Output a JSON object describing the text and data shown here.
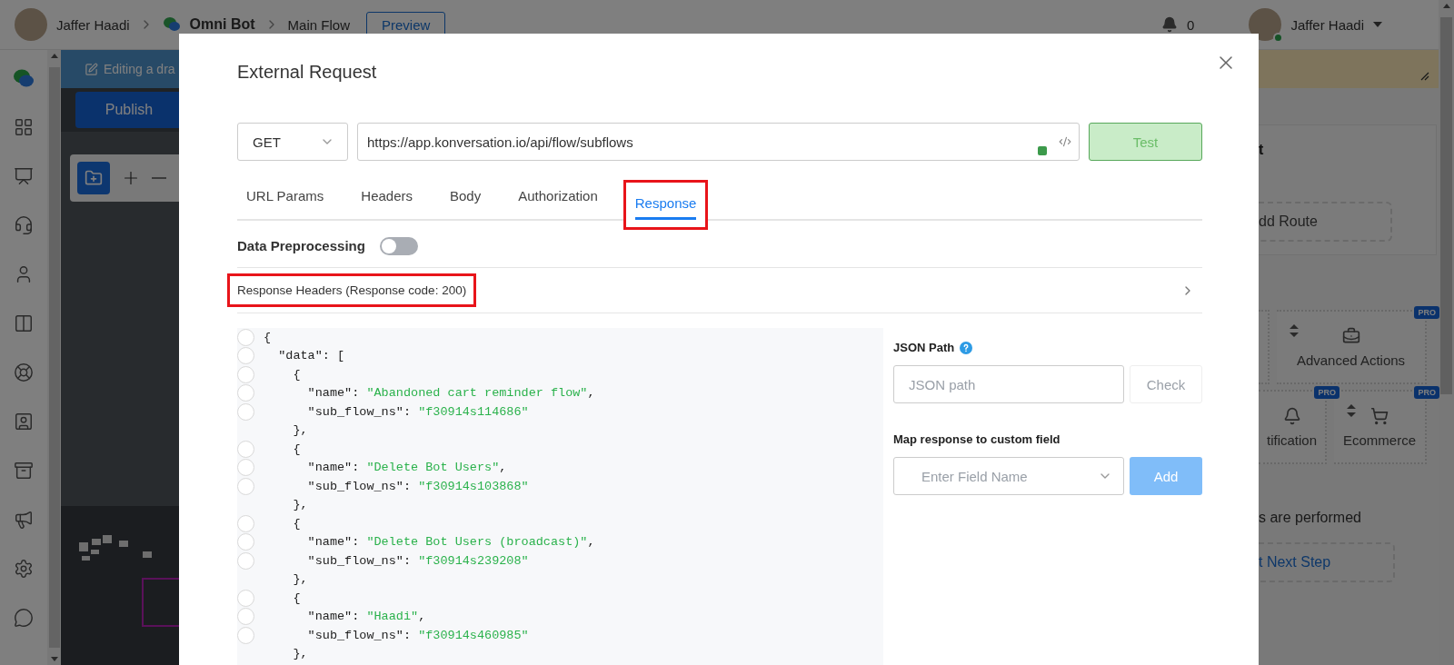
{
  "top_bar": {
    "user_name": "Jaffer Haadi",
    "bot_name": "Omni Bot",
    "flow_name": "Main Flow",
    "preview_button": "Preview",
    "notification_count": "0",
    "account_name": "Jaffer Haadi"
  },
  "editor": {
    "banner": "Editing a dra",
    "publish_button": "Publish"
  },
  "right_panel": {
    "heading": "t",
    "add_route": "dd Route",
    "actions": [
      {
        "label": "Advanced Actions",
        "badge": "PRO"
      },
      {
        "label": "tification",
        "badge": "PRO"
      },
      {
        "label": "Ecommerce",
        "badge": "PRO"
      }
    ],
    "note": "s are performed",
    "next_step": "t Next Step"
  },
  "modal": {
    "title": "External Request",
    "method": "GET",
    "url": "https://app.konversation.io/api/flow/subflows",
    "test_button": "Test",
    "tabs": [
      {
        "label": "URL Params",
        "selected": false,
        "highlighted": false
      },
      {
        "label": "Headers",
        "selected": false,
        "highlighted": false
      },
      {
        "label": "Body",
        "selected": false,
        "highlighted": false
      },
      {
        "label": "Authorization",
        "selected": false,
        "highlighted": false
      },
      {
        "label": "Response",
        "selected": true,
        "highlighted": true
      }
    ],
    "data_preprocessing": {
      "label": "Data Preprocessing",
      "on": false
    },
    "response_headers": {
      "label": "Response Headers (Response code: 200)",
      "highlighted": true
    },
    "code_lines": [
      {
        "fold": true,
        "parts": [
          {
            "kind": "plain",
            "text": "{"
          }
        ]
      },
      {
        "fold": true,
        "parts": [
          {
            "kind": "plain",
            "text": "  \"data\": ["
          }
        ]
      },
      {
        "fold": true,
        "parts": [
          {
            "kind": "plain",
            "text": "    {"
          }
        ]
      },
      {
        "fold": true,
        "parts": [
          {
            "kind": "plain",
            "text": "      \"name\": "
          },
          {
            "kind": "string",
            "text": "\"Abandoned cart reminder flow\""
          },
          {
            "kind": "plain",
            "text": ","
          }
        ]
      },
      {
        "fold": true,
        "parts": [
          {
            "kind": "plain",
            "text": "      \"sub_flow_ns\": "
          },
          {
            "kind": "string",
            "text": "\"f30914s114686\""
          }
        ]
      },
      {
        "fold": false,
        "parts": [
          {
            "kind": "plain",
            "text": "    },"
          }
        ]
      },
      {
        "fold": true,
        "parts": [
          {
            "kind": "plain",
            "text": "    {"
          }
        ]
      },
      {
        "fold": true,
        "parts": [
          {
            "kind": "plain",
            "text": "      \"name\": "
          },
          {
            "kind": "string",
            "text": "\"Delete Bot Users\""
          },
          {
            "kind": "plain",
            "text": ","
          }
        ]
      },
      {
        "fold": true,
        "parts": [
          {
            "kind": "plain",
            "text": "      \"sub_flow_ns\": "
          },
          {
            "kind": "string",
            "text": "\"f30914s103868\""
          }
        ]
      },
      {
        "fold": false,
        "parts": [
          {
            "kind": "plain",
            "text": "    },"
          }
        ]
      },
      {
        "fold": true,
        "parts": [
          {
            "kind": "plain",
            "text": "    {"
          }
        ]
      },
      {
        "fold": true,
        "parts": [
          {
            "kind": "plain",
            "text": "      \"name\": "
          },
          {
            "kind": "string",
            "text": "\"Delete Bot Users (broadcast)\""
          },
          {
            "kind": "plain",
            "text": ","
          }
        ]
      },
      {
        "fold": true,
        "parts": [
          {
            "kind": "plain",
            "text": "      \"sub_flow_ns\": "
          },
          {
            "kind": "string",
            "text": "\"f30914s239208\""
          }
        ]
      },
      {
        "fold": false,
        "parts": [
          {
            "kind": "plain",
            "text": "    },"
          }
        ]
      },
      {
        "fold": true,
        "parts": [
          {
            "kind": "plain",
            "text": "    {"
          }
        ]
      },
      {
        "fold": true,
        "parts": [
          {
            "kind": "plain",
            "text": "      \"name\": "
          },
          {
            "kind": "string",
            "text": "\"Haadi\""
          },
          {
            "kind": "plain",
            "text": ","
          }
        ]
      },
      {
        "fold": true,
        "parts": [
          {
            "kind": "plain",
            "text": "      \"sub_flow_ns\": "
          },
          {
            "kind": "string",
            "text": "\"f30914s460985\""
          }
        ]
      },
      {
        "fold": false,
        "parts": [
          {
            "kind": "plain",
            "text": "    },"
          }
        ]
      }
    ],
    "json_path": {
      "label": "JSON Path",
      "placeholder": "JSON path",
      "button": "Check"
    },
    "map_field": {
      "label": "Map response to custom field",
      "placeholder": "Enter Field Name",
      "button": "Add"
    }
  }
}
